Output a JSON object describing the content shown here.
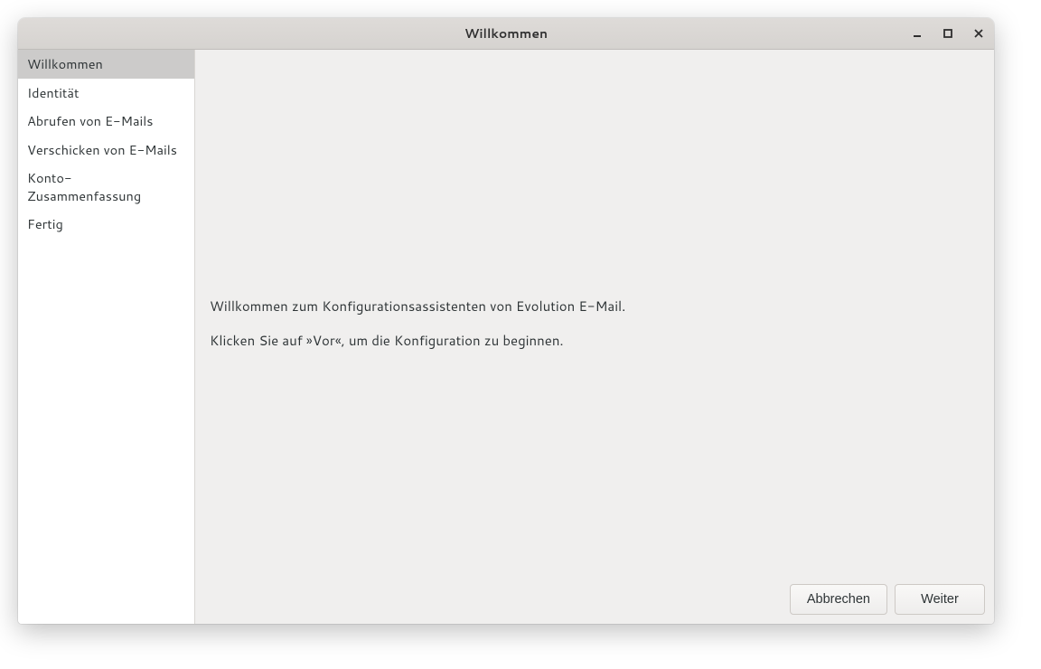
{
  "titlebar": {
    "title": "Willkommen"
  },
  "sidebar": {
    "items": [
      {
        "label": "Willkommen",
        "selected": true
      },
      {
        "label": "Identität",
        "selected": false
      },
      {
        "label": "Abrufen von E-Mails",
        "selected": false
      },
      {
        "label": "Verschicken von E-Mails",
        "selected": false
      },
      {
        "label": "Konto-Zusammenfassung",
        "selected": false
      },
      {
        "label": "Fertig",
        "selected": false
      }
    ]
  },
  "main": {
    "welcome_line1": "Willkommen zum Konfigurationsassistenten von Evolution E-Mail.",
    "welcome_line2": "Klicken Sie auf »Vor«, um die Konfiguration zu beginnen."
  },
  "buttons": {
    "cancel": "Abbrechen",
    "next": "Weiter"
  }
}
